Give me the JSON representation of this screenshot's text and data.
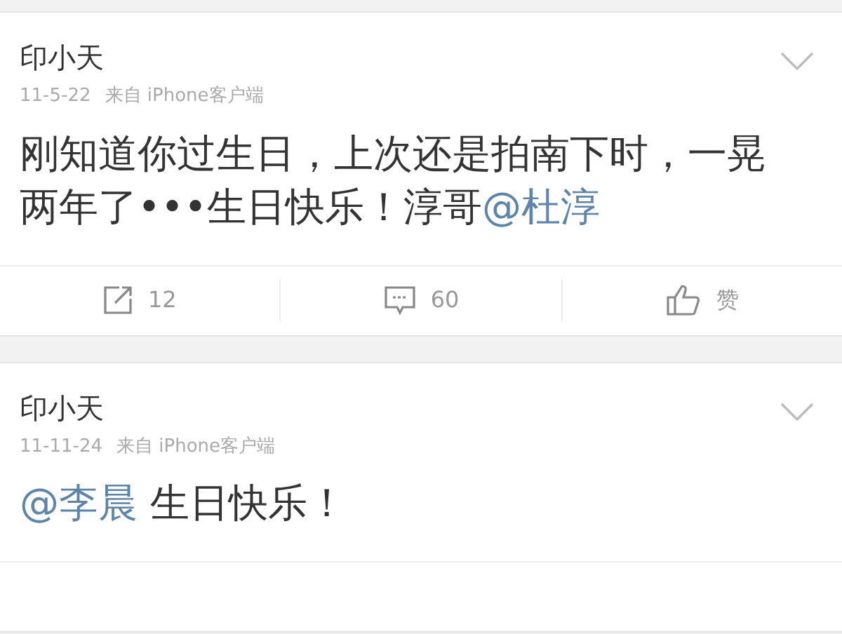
{
  "posts": [
    {
      "author": "印小天",
      "time": "11-5-22",
      "source": "来自 iPhone客户端",
      "body": [
        {
          "kind": "text",
          "text": "刚知道你过生日，上次还是拍南下时，一晃两年了•••生日快乐！淳哥"
        },
        {
          "kind": "mention",
          "text": "@杜淳"
        }
      ],
      "actions": [
        {
          "kind": "repost",
          "label": "12"
        },
        {
          "kind": "comment",
          "label": "60"
        },
        {
          "kind": "like",
          "label": "赞"
        }
      ]
    },
    {
      "author": "印小天",
      "time": "11-11-24",
      "source": "来自 iPhone客户端",
      "body": [
        {
          "kind": "mention",
          "text": "@李晨"
        },
        {
          "kind": "text",
          "text": " 生日快乐！"
        }
      ]
    }
  ]
}
